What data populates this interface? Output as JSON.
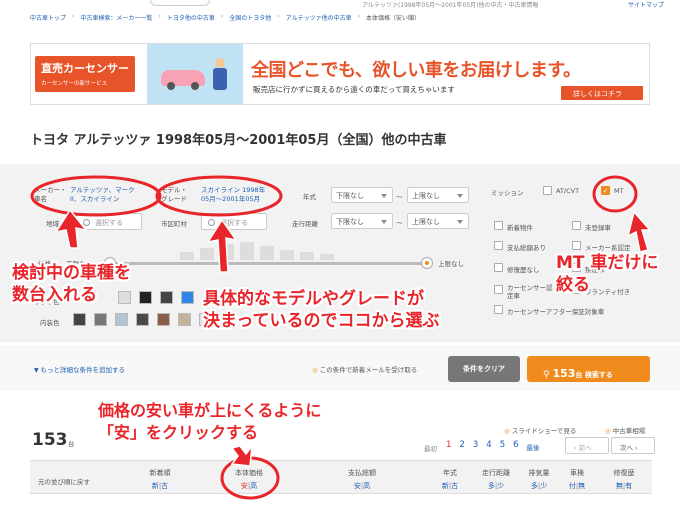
{
  "top": {
    "tab_fragment": "...",
    "breadcrumb_right": "アルテッツァ(1998年05月〜2001年05月)他の中古・中古車情報",
    "sitemap": "サイトマップ"
  },
  "breadcrumb": {
    "items": [
      "中古車トップ",
      "中古車検索：メーカー一覧",
      "トヨタ他の中古車",
      "全国のトヨタ他",
      "アルテッツァ他の中古車",
      "本体価格（安い順）"
    ]
  },
  "banner": {
    "logo_main": "直売カーセンサー",
    "logo_sub": "カーセンサーの新サービス",
    "headline": "全国どこでも、欲しい車をお届けします。",
    "subline": "販売店に行かずに買えるから遠くの車だって買えちゃいます",
    "cta": "詳しくはコチラ",
    "brand_color": "#e8542a"
  },
  "page_title": "トヨタ アルテッツァ 1998年05月〜2001年05月（全国）他の中古車",
  "search": {
    "maker_label": "メーカー・\n車名",
    "maker_value": "アルテッツァ、マーク\nII、スカイライン",
    "model_label": "モデル・\nグレード",
    "model_value": "スカイライン 1998年\n05月〜2001年05月",
    "year_label": "年式",
    "year_from": "下限なし",
    "year_to": "上限なし",
    "mileage_label": "走行距離",
    "mileage_from": "下限なし",
    "mileage_to": "上限なし",
    "area_label": "地域",
    "area_placeholder": "選択する",
    "city_label": "市区町村",
    "city_placeholder": "選択する",
    "range_tilde": "〜",
    "price_label": "価格",
    "price_min": "下限なし",
    "price_max": "上限なし",
    "body_color_label": "ボディ色",
    "interior_label": "内装色",
    "mission_label": "ミッション",
    "at_label": "AT/CVT",
    "mt_label": "MT",
    "options": [
      "新着物件",
      "未登録車",
      "支払総額あり",
      "メーカー系認定",
      "修復歴なし",
      "禁煙車",
      "カーセンサー認定車",
      "ワランティ付き",
      "カーセンサーアフター保証対象車"
    ],
    "more_conditions": "もっと詳細な条件を追加する",
    "save_alert": "この条件で新着メールを受け取る",
    "clear_btn": "条件をクリア",
    "search_count": "153",
    "search_btn_suffix": "台 検索する"
  },
  "results": {
    "slideshow": "スライドショーで見る",
    "market": "中古車相場",
    "count": "153",
    "count_unit": "台",
    "pagination_prefix": "最初",
    "pages": [
      "1",
      "2",
      "3",
      "4",
      "5",
      "6"
    ],
    "pagination_suffix": "最後",
    "prev": "前へ",
    "next": "次へ",
    "sort_reset": "元の並び順に戻す",
    "columns": [
      {
        "label": "新着順",
        "a": "新",
        "b": "古"
      },
      {
        "label": "本体価格",
        "a": "安",
        "b": "高"
      },
      {
        "label": "支払総額",
        "a": "安",
        "b": "高"
      },
      {
        "label": "年式",
        "a": "新",
        "b": "古"
      },
      {
        "label": "走行距離",
        "a": "多",
        "b": "少"
      },
      {
        "label": "排気量",
        "a": "多",
        "b": "少"
      },
      {
        "label": "車検",
        "a": "付",
        "b": "無"
      },
      {
        "label": "修復歴",
        "a": "無",
        "b": "有"
      }
    ]
  },
  "annotations": {
    "a1": "検討中の車種を\n数台入れる",
    "a2": "具体的なモデルやグレードが\n決まっているのでココから選ぶ",
    "a3": "MT 車だけに\n絞る",
    "a4": "価格の安い車が上にくるように\n「安」をクリックする",
    "color": "#e8252b"
  }
}
